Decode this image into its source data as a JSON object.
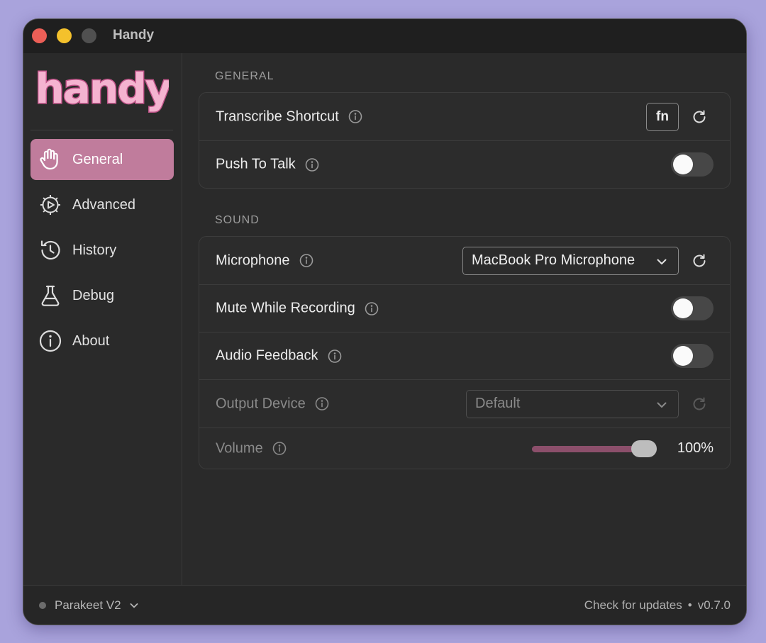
{
  "window": {
    "title": "Handy"
  },
  "logo": {
    "text": "handy"
  },
  "colors": {
    "accent": "#c07c9c",
    "logo_pink": "#f4b3d0",
    "logo_outline": "#c2568b",
    "window_bg": "#2a2a2a",
    "desktop_bg": "#a9a3dc"
  },
  "sidebar": {
    "items": [
      {
        "label": "General",
        "icon": "hand-wave-icon",
        "active": true
      },
      {
        "label": "Advanced",
        "icon": "gear-play-icon",
        "active": false
      },
      {
        "label": "History",
        "icon": "history-clock-icon",
        "active": false
      },
      {
        "label": "Debug",
        "icon": "flask-icon",
        "active": false
      },
      {
        "label": "About",
        "icon": "info-circle-icon",
        "active": false
      }
    ]
  },
  "general": {
    "title": "GENERAL",
    "transcribe_shortcut": {
      "label": "Transcribe Shortcut",
      "key": "fn"
    },
    "push_to_talk": {
      "label": "Push To Talk",
      "enabled": false
    }
  },
  "sound": {
    "title": "SOUND",
    "microphone": {
      "label": "Microphone",
      "value": "MacBook Pro Microphone"
    },
    "mute_while_recording": {
      "label": "Mute While Recording",
      "enabled": false
    },
    "audio_feedback": {
      "label": "Audio Feedback",
      "enabled": false
    },
    "output_device": {
      "label": "Output Device",
      "value": "Default",
      "disabled": true
    },
    "volume": {
      "label": "Volume",
      "value": 1.0,
      "display": "100%",
      "disabled": true
    }
  },
  "footer": {
    "model": "Parakeet V2",
    "check_updates": "Check for updates",
    "separator": "•",
    "version": "v0.7.0"
  }
}
